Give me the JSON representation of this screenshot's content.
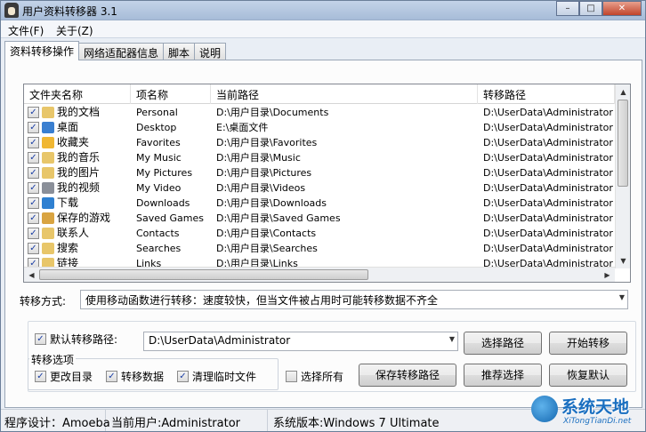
{
  "window": {
    "title": "用户资料转移器 3.1"
  },
  "window_buttons": {
    "minimize": "–",
    "maximize": "□",
    "close": "✕"
  },
  "menu": [
    {
      "label": "文件(F)"
    },
    {
      "label": "关于(Z)"
    }
  ],
  "tabs": [
    {
      "label": "资料转移操作",
      "active": true
    },
    {
      "label": "网络适配器信息",
      "active": false
    },
    {
      "label": "脚本",
      "active": false
    },
    {
      "label": "说明",
      "active": false
    }
  ],
  "list": {
    "columns": [
      "文件夹名称",
      "项名称",
      "当前路径",
      "转移路径"
    ],
    "rows": [
      {
        "checked": true,
        "icon": "documents-folder-icon",
        "icon_color": "#e8c66a",
        "name": "我的文档",
        "item": "Personal",
        "current": "D:\\用户目录\\Documents",
        "target": "D:\\UserData\\Administrator"
      },
      {
        "checked": true,
        "icon": "desktop-icon",
        "icon_color": "#3a7fd0",
        "name": "桌面",
        "item": "Desktop",
        "current": "E:\\桌面文件",
        "target": "D:\\UserData\\Administrator"
      },
      {
        "checked": true,
        "icon": "favorites-star-icon",
        "icon_color": "#f0b733",
        "name": "收藏夹",
        "item": "Favorites",
        "current": "D:\\用户目录\\Favorites",
        "target": "D:\\UserData\\Administrator"
      },
      {
        "checked": true,
        "icon": "music-folder-icon",
        "icon_color": "#e8c66a",
        "name": "我的音乐",
        "item": "My Music",
        "current": "D:\\用户目录\\Music",
        "target": "D:\\UserData\\Administrator"
      },
      {
        "checked": true,
        "icon": "pictures-folder-icon",
        "icon_color": "#e8c66a",
        "name": "我的图片",
        "item": "My Pictures",
        "current": "D:\\用户目录\\Pictures",
        "target": "D:\\UserData\\Administrator"
      },
      {
        "checked": true,
        "icon": "video-folder-icon",
        "icon_color": "#8a8f99",
        "name": "我的视频",
        "item": "My Video",
        "current": "D:\\用户目录\\Videos",
        "target": "D:\\UserData\\Administrator"
      },
      {
        "checked": true,
        "icon": "downloads-arrow-icon",
        "icon_color": "#2f80d1",
        "name": "下载",
        "item": "Downloads",
        "current": "D:\\用户目录\\Downloads",
        "target": "D:\\UserData\\Administrator"
      },
      {
        "checked": true,
        "icon": "saved-games-icon",
        "icon_color": "#d9a441",
        "name": "保存的游戏",
        "item": "Saved Games",
        "current": "D:\\用户目录\\Saved Games",
        "target": "D:\\UserData\\Administrator"
      },
      {
        "checked": true,
        "icon": "contacts-folder-icon",
        "icon_color": "#e8c66a",
        "name": "联系人",
        "item": "Contacts",
        "current": "D:\\用户目录\\Contacts",
        "target": "D:\\UserData\\Administrator"
      },
      {
        "checked": true,
        "icon": "searches-folder-icon",
        "icon_color": "#e8c66a",
        "name": "搜索",
        "item": "Searches",
        "current": "D:\\用户目录\\Searches",
        "target": "D:\\UserData\\Administrator"
      },
      {
        "checked": true,
        "icon": "links-folder-icon",
        "icon_color": "#e8c66a",
        "name": "链接",
        "item": "Links",
        "current": "D:\\用户目录\\Links",
        "target": "D:\\UserData\\Administrator"
      }
    ]
  },
  "transfer_mode": {
    "label": "转移方式:",
    "value": "使用移动函数进行转移：速度较快，但当文件被占用时可能转移数据不齐全"
  },
  "default_path": {
    "checked": true,
    "label": "默认转移路径:",
    "value": "D:\\UserData\\Administrator"
  },
  "options": {
    "group_label": "转移选项",
    "change_dir": {
      "checked": true,
      "label": "更改目录"
    },
    "transfer_data": {
      "checked": true,
      "label": "转移数据"
    },
    "clean_temp": {
      "checked": true,
      "label": "清理临时文件"
    },
    "select_all": {
      "checked": false,
      "label": "选择所有"
    }
  },
  "buttons": {
    "choose_path": "选择路径",
    "start": "开始转移",
    "save_path": "保存转移路径",
    "recommend": "推荐选择",
    "restore_default": "恢复默认"
  },
  "status": {
    "designer": "程序设计：Amoeba",
    "current_user": "当前用户:Administrator",
    "system_version": "系统版本:Windows 7 Ultimate"
  },
  "watermark": {
    "title": "系统天地",
    "url": "XiTongTianDi.net"
  }
}
